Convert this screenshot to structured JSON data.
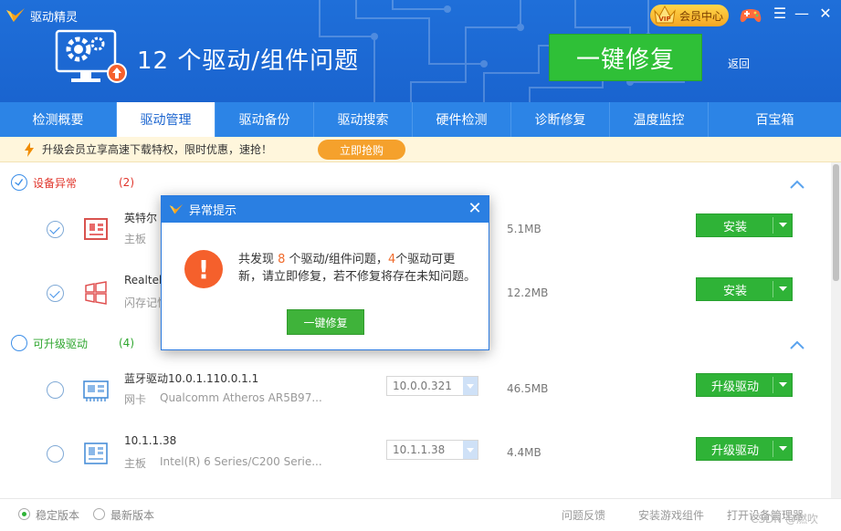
{
  "app": {
    "name": "驱动精灵"
  },
  "header": {
    "vip_label": "会员中心",
    "issue_title": "12 个驱动/组件问题",
    "fix_all_label": "一键修复",
    "back_label": "返回",
    "window_buttons": {
      "menu": "☰",
      "minimize": "—",
      "close": "✕"
    }
  },
  "tabs": [
    {
      "label": "检测概要"
    },
    {
      "label": "驱动管理",
      "active": true
    },
    {
      "label": "驱动备份"
    },
    {
      "label": "驱动搜索"
    },
    {
      "label": "硬件检测"
    },
    {
      "label": "诊断修复"
    },
    {
      "label": "温度监控"
    },
    {
      "label": "百宝箱"
    }
  ],
  "promo": {
    "text": "升级会员立享高速下载特权，限时优惠，速抢！",
    "button": "立即抢购"
  },
  "sections": {
    "abnormal": {
      "title": "设备异常",
      "count": "(2)"
    },
    "upgradable": {
      "title": "可升级驱动",
      "count": "(4)"
    }
  },
  "rows": [
    {
      "name": "英特尔",
      "category": "主板",
      "description": "",
      "version": "",
      "size": "5.1MB",
      "action": "安装",
      "checked": true,
      "icon": "motherboard-icon"
    },
    {
      "name": "Realtek",
      "category": "闪存记忆",
      "description": "",
      "version": "",
      "size": "12.2MB",
      "action": "安装",
      "checked": true,
      "icon": "windows-icon"
    },
    {
      "name": "蓝牙驱动10.0.1.110.0.1.1",
      "category": "网卡",
      "description": "Qualcomm Atheros AR5B97...",
      "version": "10.0.0.321",
      "size": "46.5MB",
      "action": "升级驱动",
      "checked": false,
      "icon": "network-card-icon"
    },
    {
      "name": "10.1.1.38",
      "category": "主板",
      "description": "Intel(R) 6 Series/C200 Serie...",
      "version": "10.1.1.38",
      "size": "4.4MB",
      "action": "升级驱动",
      "checked": false,
      "icon": "chipset-icon"
    }
  ],
  "footer": {
    "stable_label": "稳定版本",
    "latest_label": "最新版本",
    "feedback": "问题反馈",
    "install_game": "安装游戏组件",
    "device_manager": "打开设备管理器",
    "watermark": "CSDN @燃吹"
  },
  "dialog": {
    "title": "异常提示",
    "close": "✕",
    "msg_prefix": "共发现 ",
    "issue_count": "8",
    "msg_mid": " 个驱动/组件问题，",
    "update_count": "4",
    "msg_suffix": "个驱动可更新，请立即修复，若不修复将存在未知问题。",
    "button": "一键修复"
  },
  "colors": {
    "primary": "#1f6fd9",
    "green": "#2fb337",
    "orange": "#f5602c",
    "promo_bg": "#fff6dc"
  }
}
